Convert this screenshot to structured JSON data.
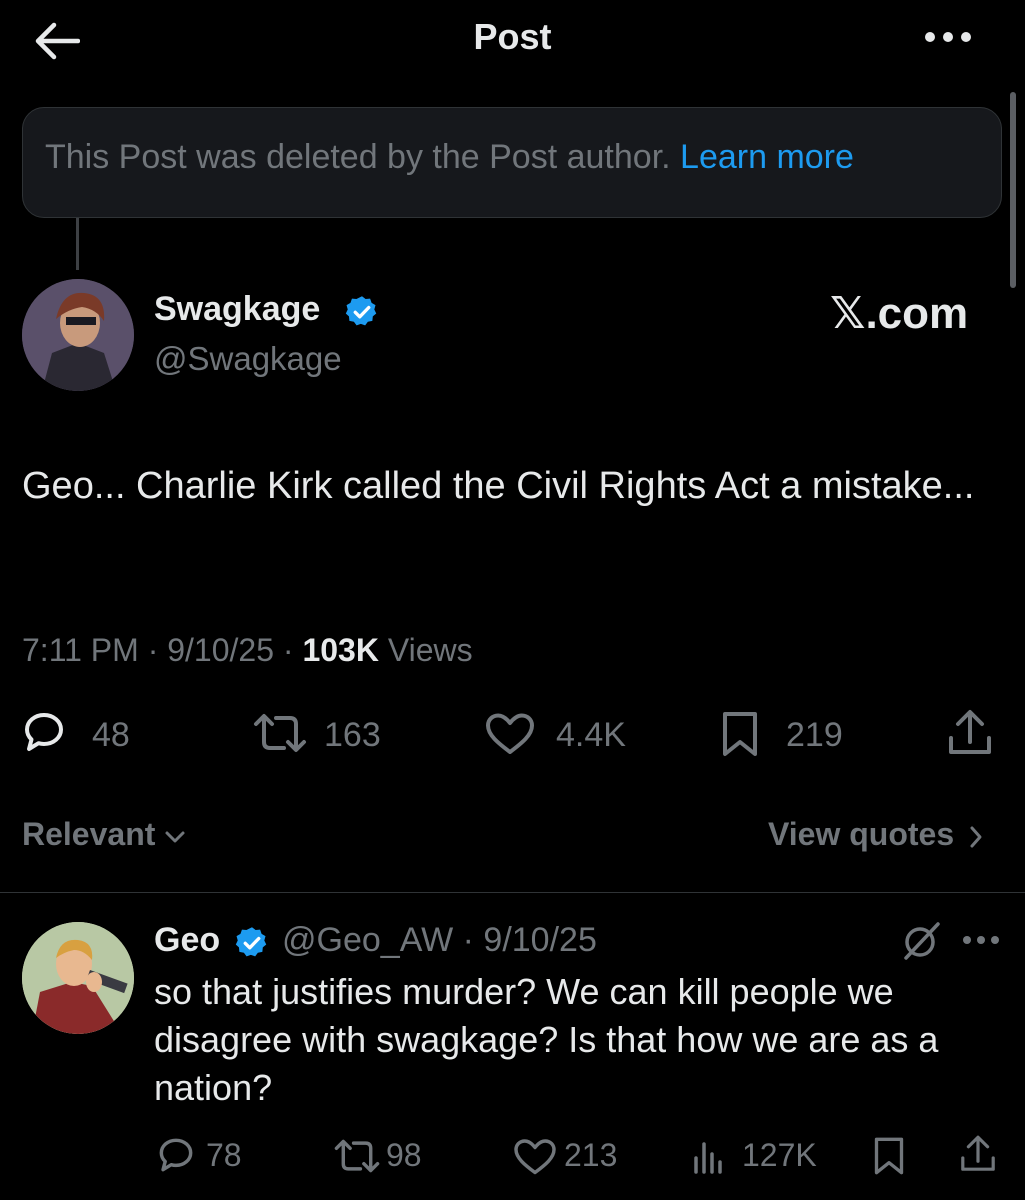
{
  "header": {
    "title": "Post",
    "back_icon": "arrow-left-icon",
    "more_icon": "more-horizontal-icon"
  },
  "banner": {
    "text": "This Post was deleted by the Post author.",
    "link": "Learn more"
  },
  "main_post": {
    "author_name": "Swagkage",
    "author_handle": "@Swagkage",
    "verified": true,
    "source_watermark": "𝕏.com",
    "text": "Geo... Charlie Kirk called the Civil Rights Act a mistake...",
    "time": "7:11 PM",
    "date": "9/10/25",
    "views_count": "103K",
    "views_label": "Views",
    "separator": "·",
    "actions": {
      "replies": "48",
      "reposts": "163",
      "likes": "4.4K",
      "bookmarks": "219"
    }
  },
  "sort": {
    "label": "Relevant",
    "chevron": "⌄"
  },
  "view_quotes": {
    "label": "View quotes",
    "chevron": "›"
  },
  "reply": {
    "author_name": "Geo",
    "verified": true,
    "handle_date": "@Geo_AW · 9/10/25",
    "text": "so that justifies murder? We can kill people we disagree with swagkage? Is that how we are as a nation?",
    "actions": {
      "replies": "78",
      "reposts": "98",
      "likes": "213",
      "views": "127K"
    }
  },
  "colors": {
    "background": "#000000",
    "text_primary": "#e7e9ea",
    "text_secondary": "#71767b",
    "link": "#1d9bf0",
    "border": "#2f3336"
  }
}
